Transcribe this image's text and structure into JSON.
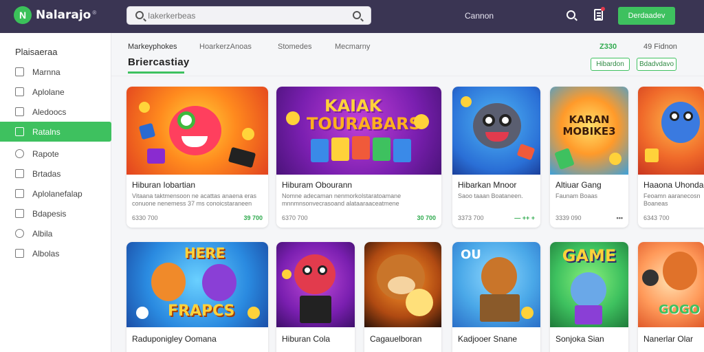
{
  "app": {
    "logo_text": "Nalarajo",
    "logo_mark": "N"
  },
  "topbar": {
    "search_placeholder": "Iakerkerbeas",
    "link": "Cannon",
    "button": "Derdaadev",
    "icons": [
      "search-icon",
      "notifications-icon"
    ]
  },
  "sidebar": {
    "title": "Plaisaeraa",
    "items": [
      {
        "label": "Marnna",
        "icon": "square-icon"
      },
      {
        "label": "Aplolane",
        "icon": "square-icon"
      },
      {
        "label": "Aledoocs",
        "icon": "square-icon"
      },
      {
        "label": "Ratalns",
        "icon": "square-icon",
        "active": true
      },
      {
        "label": "Rapote",
        "icon": "circle-icon"
      },
      {
        "label": "Brtadas",
        "icon": "square-icon"
      },
      {
        "label": "Aplolanefalap",
        "icon": "square-icon"
      },
      {
        "label": "Bdapesis",
        "icon": "square-icon"
      },
      {
        "label": "Albila",
        "icon": "circle-icon"
      },
      {
        "label": "Albolas",
        "icon": "square-icon"
      }
    ]
  },
  "tabs": [
    "Markeyphokes",
    "HoarkerzAnoas",
    "Stomedes",
    "Mecmarny"
  ],
  "section": {
    "title": "Briercastiay",
    "stat_value": "Z330",
    "stat_label": "49 Fidnon",
    "btn1": "Hibardon",
    "btn2": "Bdadvdavo"
  },
  "row1": [
    {
      "title": "Hiburan Iobartian",
      "desc": "Vitaana taktmensoon ne acattas anaena eras conuone nenemess 37 ms conoicstaraneen reoasnecolss Snouras.",
      "meta": "6330 700",
      "meta_r": "39 700"
    },
    {
      "title": "Hiburam Obourann",
      "desc": "Nomne adecaman nenmorkolstaratoamane mnnmnsonvecrasoand alataaraaceatmene earoaasaand naaranoo.",
      "meta": "6370 700",
      "meta_r": "30 700"
    },
    {
      "title": "Hibarkan Mnoor",
      "desc": "Saoo taaan Boataneen.",
      "meta": "3373 700",
      "meta_r": "— ++ +"
    },
    {
      "title": "Altiuar Gang",
      "desc": "Faunam Boaas",
      "meta": "3339 090",
      "meta_r": "•••"
    },
    {
      "title": "Haaona Uhondaoaao",
      "desc": "Feoamn aaranecosn Boaneas",
      "meta": "6343 700",
      "meta_r": ""
    }
  ],
  "row2": [
    {
      "title": "Raduponigley Oomana"
    },
    {
      "title": "Hiburan Cola"
    },
    {
      "title": "Cagauelboran"
    },
    {
      "title": "Kadjooer Snane"
    },
    {
      "title": "Sonjoka Sian"
    },
    {
      "title": "Nanerlar Olar"
    }
  ],
  "art_text": {
    "card2_top": "KAIAK",
    "card2_bottom": "TOURABARS",
    "card4": "KARAN MOBIKE3",
    "row2_card1_top": "HERE",
    "row2_card1_bottom": "FRAPCS",
    "row2_card4": "OU",
    "row2_card5": "GAME",
    "row2_card6": "GOGO"
  },
  "colors": {
    "accent": "#3ec15f",
    "topbar": "#3a3553",
    "active_sidebar": "#3ec15f"
  }
}
